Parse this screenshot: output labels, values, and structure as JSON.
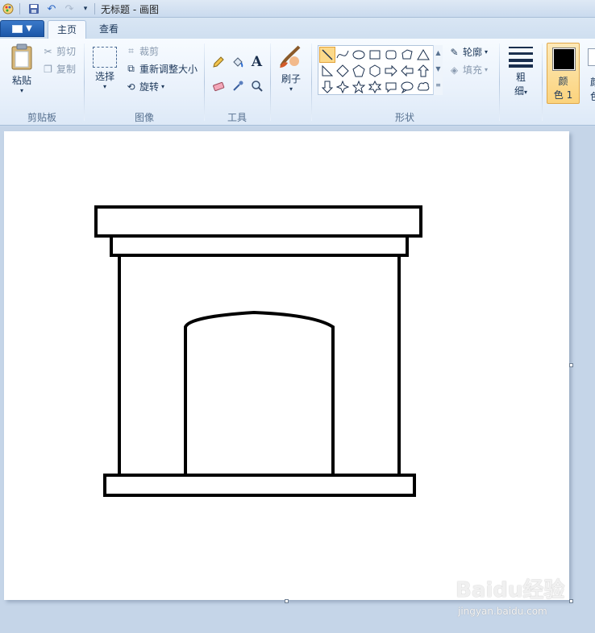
{
  "window": {
    "title": "无标题 - 画图"
  },
  "tabs": [
    {
      "label": "主页"
    },
    {
      "label": "查看"
    }
  ],
  "clipboard": {
    "paste": "粘贴",
    "cut": "剪切",
    "copy": "复制",
    "group": "剪贴板"
  },
  "image": {
    "select": "选择",
    "crop": "裁剪",
    "resize": "重新调整大小",
    "rotate": "旋转",
    "group": "图像"
  },
  "tools": {
    "group": "工具",
    "items": [
      "pencil-icon",
      "fill-bucket-icon",
      "text-icon",
      "eraser-icon",
      "color-picker-icon",
      "magnifier-icon"
    ]
  },
  "brushes": {
    "label": "刷子"
  },
  "shapes": {
    "outline": "轮廓",
    "fill": "填充",
    "group": "形状",
    "selected": "line"
  },
  "size": {
    "label1": "粗",
    "label2": "细"
  },
  "color1": {
    "label1": "颜",
    "label2": "色 1",
    "value": "#000000"
  },
  "color2": {
    "label1": "颜",
    "label2": "色"
  },
  "watermark": {
    "brand": "Baidu经验",
    "url": "jingyan.baidu.com"
  }
}
